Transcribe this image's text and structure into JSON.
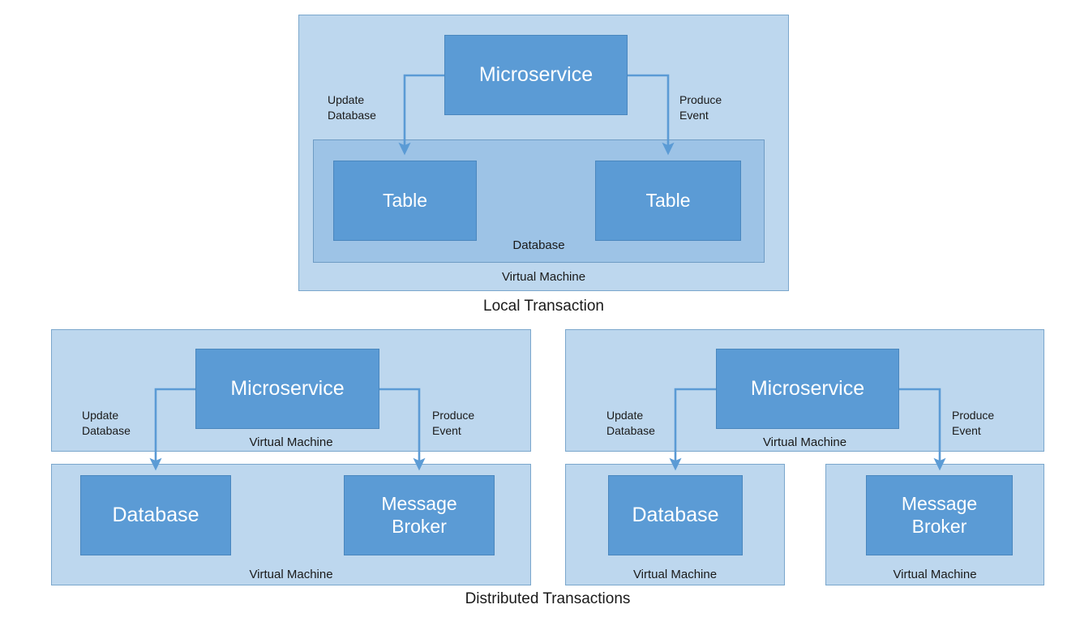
{
  "figure": {
    "title_local": "Local Transaction",
    "title_distributed": "Distributed Transactions"
  },
  "labels": {
    "microservice": "Microservice",
    "table": "Table",
    "database": "Database",
    "message_broker": "Message\nBroker",
    "virtual_machine": "Virtual Machine",
    "update_database": "Update\nDatabase",
    "produce_event": "Produce\nEvent"
  },
  "colors": {
    "node_fill": "#5B9BD5",
    "node_stroke": "#4A87BE",
    "container_fill": "#BDD7EE",
    "container_stroke": "#7BA7CC",
    "midcontainer_fill": "#9DC3E6",
    "midcontainer_stroke": "#6E9BC4",
    "connector": "#5B9BD5",
    "text_dark": "#1A1A1A",
    "text_light": "#FFFFFF",
    "background": "#FFFFFF"
  },
  "diagrams": [
    {
      "id": "local-transaction",
      "caption": "Local Transaction",
      "outer_container": "Virtual Machine",
      "inner_container": "Database",
      "service": "Microservice",
      "targets": [
        "Table",
        "Table"
      ],
      "edges": [
        {
          "label": "Update\nDatabase",
          "from": "Microservice",
          "to": "Table"
        },
        {
          "label": "Produce\nEvent",
          "from": "Microservice",
          "to": "Table"
        }
      ]
    },
    {
      "id": "distributed-transactions-left",
      "caption": "Distributed Transactions",
      "service_container": "Virtual Machine",
      "store_container": "Virtual Machine",
      "service": "Microservice",
      "targets": [
        "Database",
        "Message\nBroker"
      ],
      "edges": [
        {
          "label": "Update\nDatabase",
          "from": "Microservice",
          "to": "Database"
        },
        {
          "label": "Produce\nEvent",
          "from": "Microservice",
          "to": "Message Broker"
        }
      ]
    },
    {
      "id": "distributed-transactions-right",
      "caption": "Distributed Transactions",
      "service_container": "Virtual Machine",
      "store_containers": [
        "Virtual Machine",
        "Virtual Machine"
      ],
      "service": "Microservice",
      "targets": [
        "Database",
        "Message\nBroker"
      ],
      "edges": [
        {
          "label": "Update\nDatabase",
          "from": "Microservice",
          "to": "Database"
        },
        {
          "label": "Produce\nEvent",
          "from": "Microservice",
          "to": "Message Broker"
        }
      ]
    }
  ]
}
